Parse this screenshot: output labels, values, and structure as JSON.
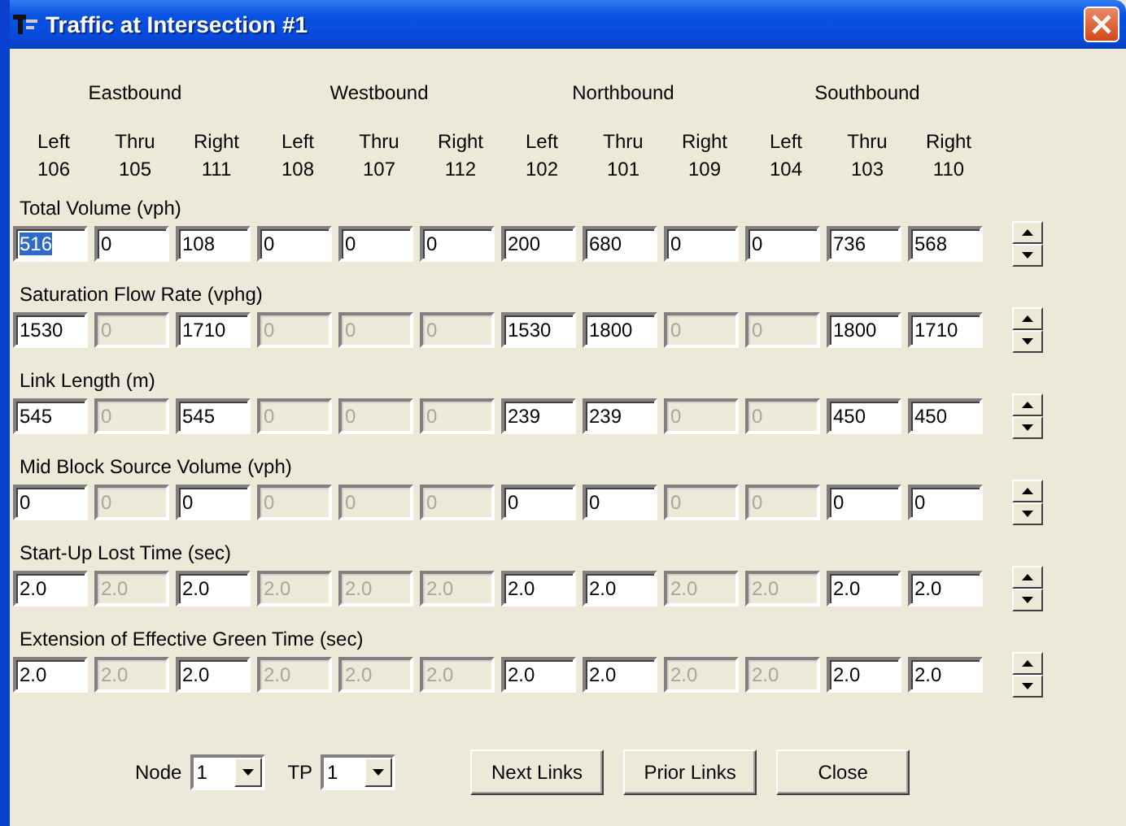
{
  "window": {
    "title": "Traffic at Intersection #1"
  },
  "directions": [
    {
      "name": "Eastbound",
      "movements": [
        {
          "label": "Left",
          "link": "106"
        },
        {
          "label": "Thru",
          "link": "105"
        },
        {
          "label": "Right",
          "link": "111"
        }
      ]
    },
    {
      "name": "Westbound",
      "movements": [
        {
          "label": "Left",
          "link": "108"
        },
        {
          "label": "Thru",
          "link": "107"
        },
        {
          "label": "Right",
          "link": "112"
        }
      ]
    },
    {
      "name": "Northbound",
      "movements": [
        {
          "label": "Left",
          "link": "102"
        },
        {
          "label": "Thru",
          "link": "101"
        },
        {
          "label": "Right",
          "link": "109"
        }
      ]
    },
    {
      "name": "Southbound",
      "movements": [
        {
          "label": "Left",
          "link": "104"
        },
        {
          "label": "Thru",
          "link": "103"
        },
        {
          "label": "Right",
          "link": "110"
        }
      ]
    }
  ],
  "parameters": [
    {
      "label": "Total Volume (vph)",
      "values": [
        {
          "value": "516",
          "disabled": false,
          "selected": true
        },
        {
          "value": "0",
          "disabled": false,
          "selected": false
        },
        {
          "value": "108",
          "disabled": false,
          "selected": false
        },
        {
          "value": "0",
          "disabled": false,
          "selected": false
        },
        {
          "value": "0",
          "disabled": false,
          "selected": false
        },
        {
          "value": "0",
          "disabled": false,
          "selected": false
        },
        {
          "value": "200",
          "disabled": false,
          "selected": false
        },
        {
          "value": "680",
          "disabled": false,
          "selected": false
        },
        {
          "value": "0",
          "disabled": false,
          "selected": false
        },
        {
          "value": "0",
          "disabled": false,
          "selected": false
        },
        {
          "value": "736",
          "disabled": false,
          "selected": false
        },
        {
          "value": "568",
          "disabled": false,
          "selected": false
        }
      ]
    },
    {
      "label": "Saturation Flow Rate  (vphg)",
      "values": [
        {
          "value": "1530",
          "disabled": false,
          "selected": false
        },
        {
          "value": "0",
          "disabled": true,
          "selected": false
        },
        {
          "value": "1710",
          "disabled": false,
          "selected": false
        },
        {
          "value": "0",
          "disabled": true,
          "selected": false
        },
        {
          "value": "0",
          "disabled": true,
          "selected": false
        },
        {
          "value": "0",
          "disabled": true,
          "selected": false
        },
        {
          "value": "1530",
          "disabled": false,
          "selected": false
        },
        {
          "value": "1800",
          "disabled": false,
          "selected": false
        },
        {
          "value": "0",
          "disabled": true,
          "selected": false
        },
        {
          "value": "0",
          "disabled": true,
          "selected": false
        },
        {
          "value": "1800",
          "disabled": false,
          "selected": false
        },
        {
          "value": "1710",
          "disabled": false,
          "selected": false
        }
      ]
    },
    {
      "label": "Link Length (m)",
      "values": [
        {
          "value": "545",
          "disabled": false,
          "selected": false
        },
        {
          "value": "0",
          "disabled": true,
          "selected": false
        },
        {
          "value": "545",
          "disabled": false,
          "selected": false
        },
        {
          "value": "0",
          "disabled": true,
          "selected": false
        },
        {
          "value": "0",
          "disabled": true,
          "selected": false
        },
        {
          "value": "0",
          "disabled": true,
          "selected": false
        },
        {
          "value": "239",
          "disabled": false,
          "selected": false
        },
        {
          "value": "239",
          "disabled": false,
          "selected": false
        },
        {
          "value": "0",
          "disabled": true,
          "selected": false
        },
        {
          "value": "0",
          "disabled": true,
          "selected": false
        },
        {
          "value": "450",
          "disabled": false,
          "selected": false
        },
        {
          "value": "450",
          "disabled": false,
          "selected": false
        }
      ]
    },
    {
      "label": "Mid Block Source Volume (vph)",
      "values": [
        {
          "value": "0",
          "disabled": false,
          "selected": false
        },
        {
          "value": "0",
          "disabled": true,
          "selected": false
        },
        {
          "value": "0",
          "disabled": false,
          "selected": false
        },
        {
          "value": "0",
          "disabled": true,
          "selected": false
        },
        {
          "value": "0",
          "disabled": true,
          "selected": false
        },
        {
          "value": "0",
          "disabled": true,
          "selected": false
        },
        {
          "value": "0",
          "disabled": false,
          "selected": false
        },
        {
          "value": "0",
          "disabled": false,
          "selected": false
        },
        {
          "value": "0",
          "disabled": true,
          "selected": false
        },
        {
          "value": "0",
          "disabled": true,
          "selected": false
        },
        {
          "value": "0",
          "disabled": false,
          "selected": false
        },
        {
          "value": "0",
          "disabled": false,
          "selected": false
        }
      ]
    },
    {
      "label": "Start-Up Lost Time (sec)",
      "values": [
        {
          "value": "2.0",
          "disabled": false,
          "selected": false
        },
        {
          "value": "2.0",
          "disabled": true,
          "selected": false
        },
        {
          "value": "2.0",
          "disabled": false,
          "selected": false
        },
        {
          "value": "2.0",
          "disabled": true,
          "selected": false
        },
        {
          "value": "2.0",
          "disabled": true,
          "selected": false
        },
        {
          "value": "2.0",
          "disabled": true,
          "selected": false
        },
        {
          "value": "2.0",
          "disabled": false,
          "selected": false
        },
        {
          "value": "2.0",
          "disabled": false,
          "selected": false
        },
        {
          "value": "2.0",
          "disabled": true,
          "selected": false
        },
        {
          "value": "2.0",
          "disabled": true,
          "selected": false
        },
        {
          "value": "2.0",
          "disabled": false,
          "selected": false
        },
        {
          "value": "2.0",
          "disabled": false,
          "selected": false
        }
      ]
    },
    {
      "label": "Extension of Effective Green Time (sec)",
      "values": [
        {
          "value": "2.0",
          "disabled": false,
          "selected": false
        },
        {
          "value": "2.0",
          "disabled": true,
          "selected": false
        },
        {
          "value": "2.0",
          "disabled": false,
          "selected": false
        },
        {
          "value": "2.0",
          "disabled": true,
          "selected": false
        },
        {
          "value": "2.0",
          "disabled": true,
          "selected": false
        },
        {
          "value": "2.0",
          "disabled": true,
          "selected": false
        },
        {
          "value": "2.0",
          "disabled": false,
          "selected": false
        },
        {
          "value": "2.0",
          "disabled": false,
          "selected": false
        },
        {
          "value": "2.0",
          "disabled": true,
          "selected": false
        },
        {
          "value": "2.0",
          "disabled": true,
          "selected": false
        },
        {
          "value": "2.0",
          "disabled": false,
          "selected": false
        },
        {
          "value": "2.0",
          "disabled": false,
          "selected": false
        }
      ]
    }
  ],
  "selectors": [
    {
      "label": "Node",
      "value": "1"
    },
    {
      "label": "TP",
      "value": "1"
    }
  ],
  "buttons": [
    "Next Links",
    "Prior Links",
    "Close"
  ]
}
